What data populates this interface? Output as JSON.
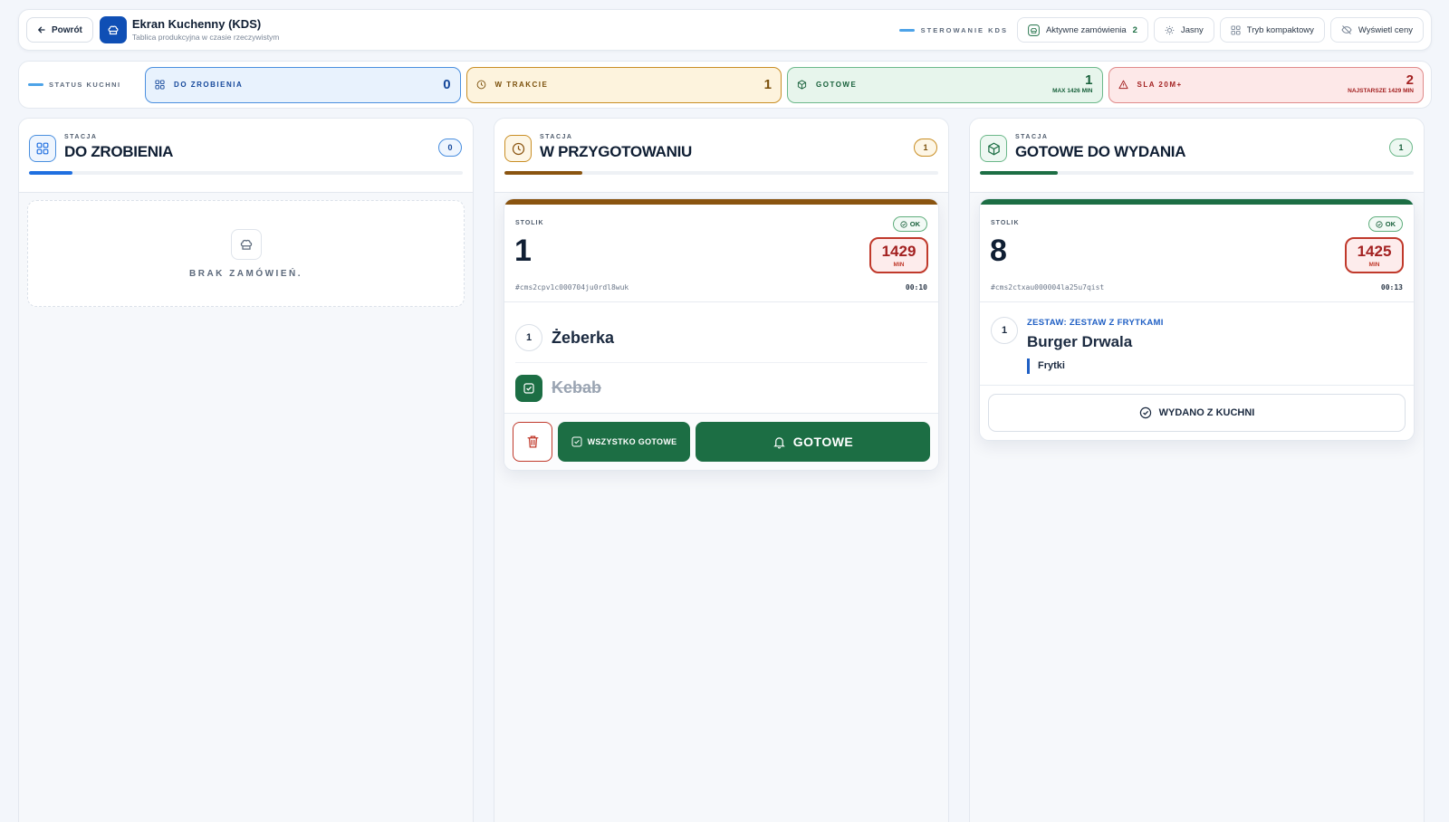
{
  "topbar": {
    "back_label": "Powrót",
    "title": "Ekran Kuchenny (KDS)",
    "subtitle": "Tablica produkcyjna w czasie rzeczywistym",
    "control_label": "STEROWANIE KDS",
    "active_orders_label": "Aktywne zamówienia",
    "active_orders_count": "2",
    "theme_label": "Jasny",
    "compact_label": "Tryb kompaktowy",
    "prices_label": "Wyświetl ceny"
  },
  "status": {
    "label": "STATUS KUCHNI",
    "todo": {
      "label": "DO ZROBIENIA",
      "value": "0"
    },
    "in_progress": {
      "label": "W TRAKCIE",
      "value": "1"
    },
    "done": {
      "label": "GOTOWE",
      "value": "1",
      "sub": "MAX 1426 MIN"
    },
    "sla": {
      "label": "SLA 20M+",
      "value": "2",
      "sub": "NAJSTARSZE 1429 MIN"
    }
  },
  "columns": {
    "todo": {
      "station_label": "STACJA",
      "title": "DO ZROBIENIA",
      "count": "0",
      "empty_text": "BRAK ZAMÓWIEŃ.",
      "accent": "#1f6fe0"
    },
    "progress": {
      "station_label": "STACJA",
      "title": "W PRZYGOTOWANIU",
      "count": "1",
      "accent": "#8a5410",
      "order": {
        "table_label": "STOLIK",
        "table": "1",
        "status": "OK",
        "minutes": "1429",
        "minutes_label": "MIN",
        "id": "#cms2cpv1c000704ju0rdl8wuk",
        "time": "00:10",
        "items": [
          {
            "qty": "1",
            "name": "Żeberka",
            "done": false
          },
          {
            "qty": "",
            "name": "Kebab",
            "done": true
          }
        ],
        "all_ready_label": "WSZYSTKO GOTOWE",
        "ready_label": "GOTOWE"
      }
    },
    "ready": {
      "station_label": "STACJA",
      "title": "GOTOWE DO WYDANIA",
      "count": "1",
      "accent": "#1c6e44",
      "order": {
        "table_label": "STOLIK",
        "table": "8",
        "status": "OK",
        "minutes": "1425",
        "minutes_label": "MIN",
        "id": "#cms2ctxau000004la25u7qist",
        "time": "00:13",
        "item_qty": "1",
        "set_label": "ZESTAW: ZESTAW Z FRYTKAMI",
        "item_name": "Burger Drwala",
        "modifier": "Frytki",
        "issue_label": "WYDANO Z KUCHNI"
      }
    }
  }
}
